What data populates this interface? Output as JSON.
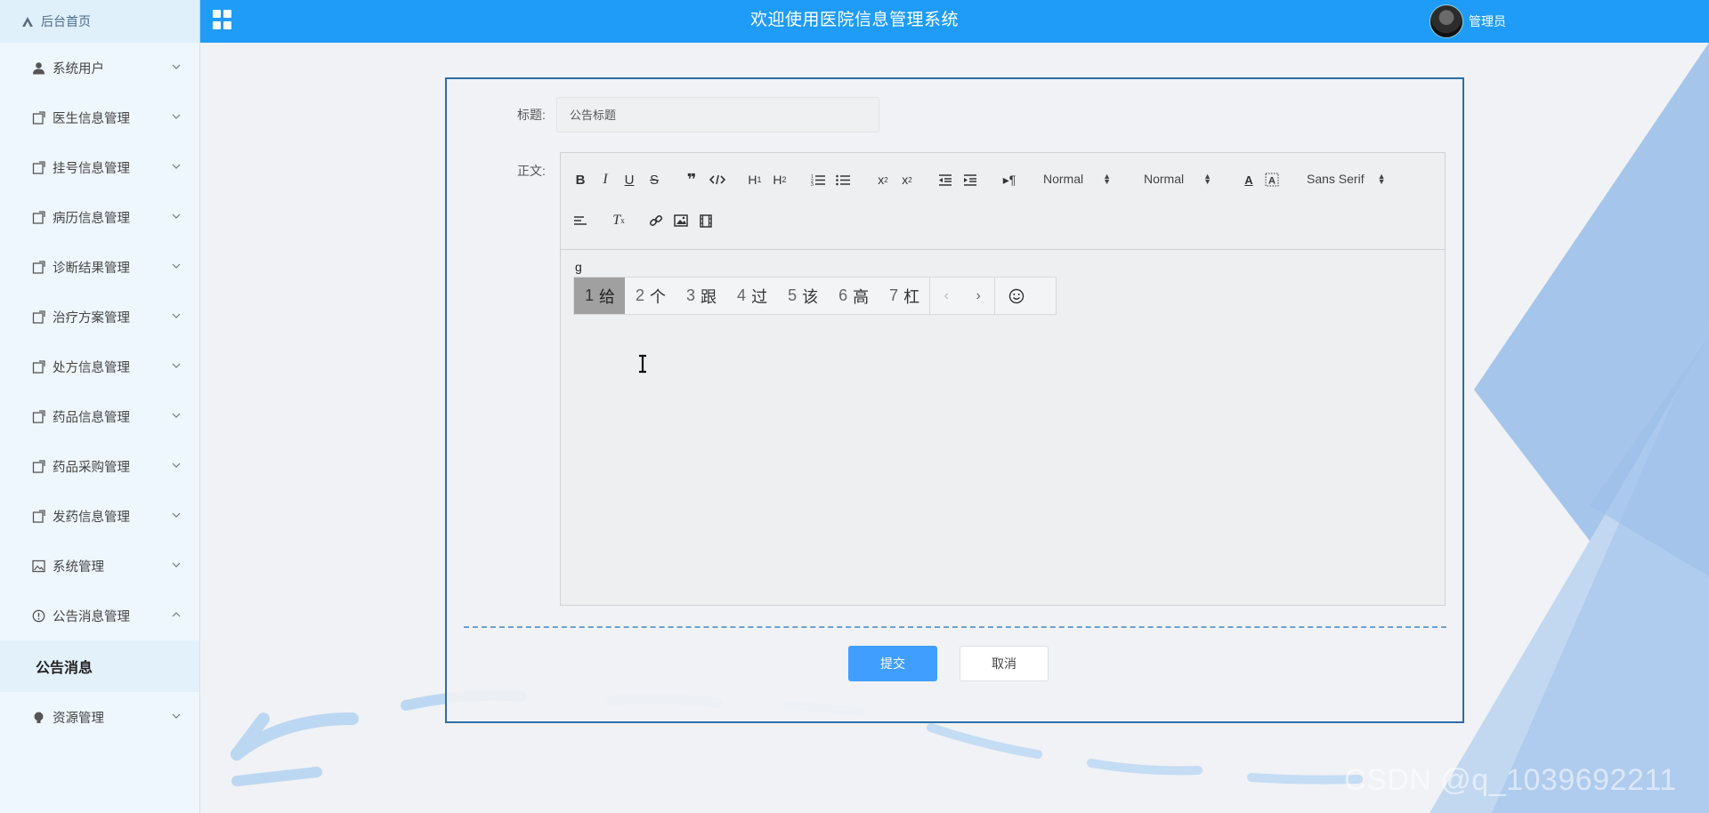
{
  "brand": {
    "home_label": "后台首页"
  },
  "header": {
    "title": "欢迎使用医院信息管理系统",
    "user_name": "管理员"
  },
  "sidebar": {
    "items": [
      {
        "label": "系统用户",
        "icon": "user-icon"
      },
      {
        "label": "医生信息管理",
        "icon": "doc-icon"
      },
      {
        "label": "挂号信息管理",
        "icon": "doc-icon"
      },
      {
        "label": "病历信息管理",
        "icon": "doc-icon"
      },
      {
        "label": "诊断结果管理",
        "icon": "doc-icon"
      },
      {
        "label": "治疗方案管理",
        "icon": "doc-icon"
      },
      {
        "label": "处方信息管理",
        "icon": "doc-icon"
      },
      {
        "label": "药品信息管理",
        "icon": "doc-icon"
      },
      {
        "label": "药品采购管理",
        "icon": "doc-icon"
      },
      {
        "label": "发药信息管理",
        "icon": "doc-icon"
      },
      {
        "label": "系统管理",
        "icon": "image-icon"
      },
      {
        "label": "公告消息管理",
        "icon": "info-icon",
        "expanded": true
      }
    ],
    "sub_item": "公告消息",
    "last_item": {
      "label": "资源管理",
      "icon": "bulb-icon"
    }
  },
  "form": {
    "title_label": "标题:",
    "title_placeholder": "公告标题",
    "body_label": "正文:",
    "typed_text": "g",
    "submit_label": "提交",
    "cancel_label": "取消"
  },
  "toolbar": {
    "header_select": "Normal",
    "size_select": "Normal",
    "font_select": "Sans Serif"
  },
  "ime": {
    "candidates": [
      {
        "num": "1",
        "text": "给"
      },
      {
        "num": "2",
        "text": "个"
      },
      {
        "num": "3",
        "text": "跟"
      },
      {
        "num": "4",
        "text": "过"
      },
      {
        "num": "5",
        "text": "该"
      },
      {
        "num": "6",
        "text": "高"
      },
      {
        "num": "7",
        "text": "杠"
      }
    ]
  },
  "watermark": "CSDN @q_1039692211",
  "colors": {
    "header": "#1e9cf8",
    "accent": "#409eff",
    "card_border": "#2a6fa7"
  }
}
